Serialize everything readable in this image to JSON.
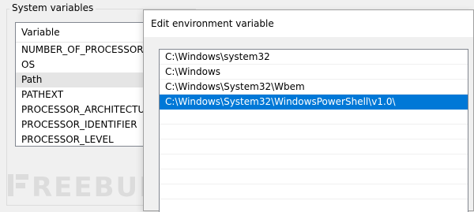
{
  "system_variables": {
    "group_title": "System variables",
    "column_header": "Variable",
    "rows": [
      {
        "name": "NUMBER_OF_PROCESSORS"
      },
      {
        "name": "OS"
      },
      {
        "name": "Path",
        "selected": true
      },
      {
        "name": "PATHEXT"
      },
      {
        "name": "PROCESSOR_ARCHITECTURE"
      },
      {
        "name": "PROCESSOR_IDENTIFIER"
      },
      {
        "name": "PROCESSOR_LEVEL"
      }
    ]
  },
  "watermark": {
    "text": "REEBUF"
  },
  "dialog": {
    "title": "Edit environment variable",
    "paths": [
      {
        "value": "C:\\Windows\\system32"
      },
      {
        "value": "C:\\Windows"
      },
      {
        "value": "C:\\Windows\\System32\\Wbem"
      },
      {
        "value": "C:\\Windows\\System32\\WindowsPowerShell\\v1.0\\",
        "selected": true
      },
      {
        "value": ""
      },
      {
        "value": ""
      },
      {
        "value": ""
      },
      {
        "value": ""
      },
      {
        "value": ""
      },
      {
        "value": ""
      }
    ]
  },
  "colors": {
    "selection_blue": "#0078d7",
    "row_highlight_gray": "#e5e5e5",
    "window_bg": "#f0f0f0"
  }
}
